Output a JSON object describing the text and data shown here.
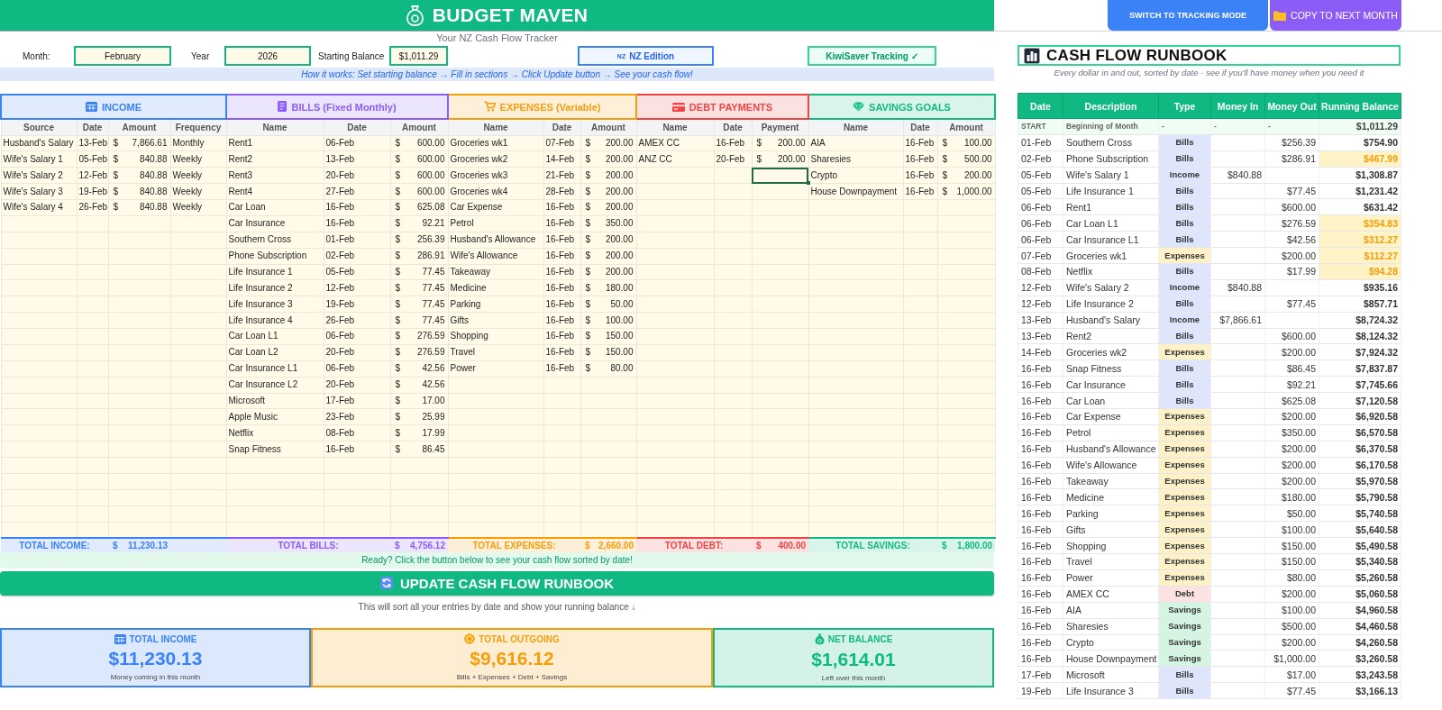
{
  "header": {
    "title": "BUDGET MAVEN",
    "subtitle": "Your NZ Cash Flow Tracker"
  },
  "controls": {
    "month_label": "Month:",
    "month": "February",
    "year_label": "Year",
    "year": "2026",
    "balance_label": "Starting Balance",
    "balance": "$1,011.29",
    "edition": {
      "badge": "NZ",
      "label": "NZ Edition"
    },
    "kiwisaver": "KiwiSaver Tracking ✓"
  },
  "how_it_works": "How it works: Set starting balance → Fill in sections → Click Update button → See your cash flow!",
  "sections": [
    {
      "kind": "income",
      "title": "INCOME",
      "color": "#3b82f6",
      "columns": [
        {
          "label": "Source",
          "kind": "text"
        },
        {
          "label": "Date",
          "kind": "text"
        },
        {
          "label": "Amount",
          "kind": "money"
        },
        {
          "label": "Frequency",
          "kind": "text"
        }
      ],
      "rows": [
        [
          "Husband's Salary",
          "13-Feb",
          [
            "$",
            "7,866.61"
          ],
          "Monthly"
        ],
        [
          "Wife's Salary 1",
          "05-Feb",
          [
            "$",
            "840.88"
          ],
          "Weekly"
        ],
        [
          "Wife's Salary 2",
          "12-Feb",
          [
            "$",
            "840.88"
          ],
          "Weekly"
        ],
        [
          "Wife's Salary 3",
          "19-Feb",
          [
            "$",
            "840.88"
          ],
          "Weekly"
        ],
        [
          "Wife's Salary 4",
          "26-Feb",
          [
            "$",
            "840.88"
          ],
          "Weekly"
        ]
      ],
      "total": {
        "label": "TOTAL INCOME:",
        "symbol": "$",
        "value": "11,230.13"
      }
    },
    {
      "kind": "bills",
      "title": "BILLS (Fixed Monthly)",
      "color": "#8b5cf6",
      "columns": [
        {
          "label": "Name",
          "kind": "text"
        },
        {
          "label": "Date",
          "kind": "text"
        },
        {
          "label": "Amount",
          "kind": "money"
        }
      ],
      "rows": [
        [
          "Rent1",
          "06-Feb",
          [
            "$",
            "600.00"
          ]
        ],
        [
          "Rent2",
          "13-Feb",
          [
            "$",
            "600.00"
          ]
        ],
        [
          "Rent3",
          "20-Feb",
          [
            "$",
            "600.00"
          ]
        ],
        [
          "Rent4",
          "27-Feb",
          [
            "$",
            "600.00"
          ]
        ],
        [
          "Car Loan",
          "16-Feb",
          [
            "$",
            "625.08"
          ]
        ],
        [
          "Car Insurance",
          "16-Feb",
          [
            "$",
            "92.21"
          ]
        ],
        [
          "Southern Cross",
          "01-Feb",
          [
            "$",
            "256.39"
          ]
        ],
        [
          "Phone Subscription",
          "02-Feb",
          [
            "$",
            "286.91"
          ]
        ],
        [
          "Life Insurance 1",
          "05-Feb",
          [
            "$",
            "77.45"
          ]
        ],
        [
          "Life Insurance 2",
          "12-Feb",
          [
            "$",
            "77.45"
          ]
        ],
        [
          "Life Insurance 3",
          "19-Feb",
          [
            "$",
            "77.45"
          ]
        ],
        [
          "Life Insurance 4",
          "26-Feb",
          [
            "$",
            "77.45"
          ]
        ],
        [
          "Car Loan L1",
          "06-Feb",
          [
            "$",
            "276.59"
          ]
        ],
        [
          "Car Loan L2",
          "20-Feb",
          [
            "$",
            "276.59"
          ]
        ],
        [
          "Car Insurance L1",
          "06-Feb",
          [
            "$",
            "42.56"
          ]
        ],
        [
          "Car Insurance L2",
          "20-Feb",
          [
            "$",
            "42.56"
          ]
        ],
        [
          "Microsoft",
          "17-Feb",
          [
            "$",
            "17.00"
          ]
        ],
        [
          "Apple Music",
          "23-Feb",
          [
            "$",
            "25.99"
          ]
        ],
        [
          "Netflix",
          "08-Feb",
          [
            "$",
            "17.99"
          ]
        ],
        [
          "Snap Fitness",
          "16-Feb",
          [
            "$",
            "86.45"
          ]
        ]
      ],
      "total": {
        "label": "TOTAL BILLS:",
        "symbol": "$",
        "value": "4,756.12"
      }
    },
    {
      "kind": "expenses",
      "title": "EXPENSES (Variable)",
      "color": "#f59e0b",
      "columns": [
        {
          "label": "Name",
          "kind": "text"
        },
        {
          "label": "Date",
          "kind": "text"
        },
        {
          "label": "Amount",
          "kind": "money"
        }
      ],
      "rows": [
        [
          "Groceries wk1",
          "07-Feb",
          [
            "$",
            "200.00"
          ]
        ],
        [
          "Groceries wk2",
          "14-Feb",
          [
            "$",
            "200.00"
          ]
        ],
        [
          "Groceries wk3",
          "21-Feb",
          [
            "$",
            "200.00"
          ]
        ],
        [
          "Groceries wk4",
          "28-Feb",
          [
            "$",
            "200.00"
          ]
        ],
        [
          "Car Expense",
          "16-Feb",
          [
            "$",
            "200.00"
          ]
        ],
        [
          "Petrol",
          "16-Feb",
          [
            "$",
            "350.00"
          ]
        ],
        [
          "Husband's Allowance",
          "16-Feb",
          [
            "$",
            "200.00"
          ]
        ],
        [
          "Wife's Allowance",
          "16-Feb",
          [
            "$",
            "200.00"
          ]
        ],
        [
          "Takeaway",
          "16-Feb",
          [
            "$",
            "200.00"
          ]
        ],
        [
          "Medicine",
          "16-Feb",
          [
            "$",
            "180.00"
          ]
        ],
        [
          "Parking",
          "16-Feb",
          [
            "$",
            "50.00"
          ]
        ],
        [
          "Gifts",
          "16-Feb",
          [
            "$",
            "100.00"
          ]
        ],
        [
          "Shopping",
          "16-Feb",
          [
            "$",
            "150.00"
          ]
        ],
        [
          "Travel",
          "16-Feb",
          [
            "$",
            "150.00"
          ]
        ],
        [
          "Power",
          "16-Feb",
          [
            "$",
            "80.00"
          ]
        ]
      ],
      "total": {
        "label": "TOTAL EXPENSES:",
        "symbol": "$",
        "value": "2,660.00"
      }
    },
    {
      "kind": "debt",
      "title": "DEBT PAYMENTS",
      "color": "#ef4444",
      "active_cell": true,
      "columns": [
        {
          "label": "Name",
          "kind": "text"
        },
        {
          "label": "Date",
          "kind": "text"
        },
        {
          "label": "Payment",
          "kind": "money"
        }
      ],
      "rows": [
        [
          "AMEX CC",
          "16-Feb",
          [
            "$",
            "200.00"
          ]
        ],
        [
          "ANZ CC",
          "20-Feb",
          [
            "$",
            "200.00"
          ]
        ]
      ],
      "total": {
        "label": "TOTAL DEBT:",
        "symbol": "$",
        "value": "400.00"
      }
    },
    {
      "kind": "savings",
      "title": "SAVINGS GOALS",
      "color": "#10b981",
      "columns": [
        {
          "label": "Name",
          "kind": "text"
        },
        {
          "label": "Date",
          "kind": "text"
        },
        {
          "label": "Amount",
          "kind": "money"
        }
      ],
      "rows": [
        [
          "AIA",
          "16-Feb",
          [
            "$",
            "100.00"
          ]
        ],
        [
          "Sharesies",
          "16-Feb",
          [
            "$",
            "500.00"
          ]
        ],
        [
          "Crypto",
          "16-Feb",
          [
            "$",
            "200.00"
          ]
        ],
        [
          "House Downpayment",
          "16-Feb",
          [
            "$",
            "1,000.00"
          ]
        ]
      ],
      "total": {
        "label": "TOTAL SAVINGS:",
        "symbol": "$",
        "value": "1,800.00"
      }
    }
  ],
  "ready_note": "Ready? Click the button below to see your cash flow sorted by date!",
  "update_button": "UPDATE CASH FLOW RUNBOOK",
  "update_caption": "This will sort all your entries by date and show your running balance ↓",
  "summary_cards": [
    {
      "kind": "income",
      "title": "TOTAL INCOME",
      "value": "$11,230.13",
      "caption": "Money coming in this month",
      "color": "#3b82f6"
    },
    {
      "kind": "outgoing",
      "title": "TOTAL OUTGOING",
      "value": "$9,616.12",
      "caption": "Bills + Expenses + Debt + Savings",
      "color": "#f59e0b"
    },
    {
      "kind": "net",
      "title": "NET BALANCE",
      "value": "$1,614.01",
      "caption": "Left over this month",
      "color": "#10b981"
    }
  ],
  "top_buttons": [
    {
      "kind": "switch",
      "label": "SWITCH TO TRACKING MODE"
    },
    {
      "kind": "copy",
      "label": "COPY TO NEXT MONTH"
    }
  ],
  "runbook": {
    "title": "CASH FLOW RUNBOOK",
    "subtitle": "Every dollar in and out, sorted by date - see if you'll have money when you need it",
    "columns": [
      "Date",
      "Description",
      "Type",
      "Money In",
      "Money Out",
      "Running Balance"
    ],
    "start": {
      "date": "START",
      "description": "Beginning of Month",
      "type": "-",
      "money_in": "-",
      "money_out": "-",
      "balance": "$1,011.29"
    },
    "rows": [
      {
        "date": "01-Feb",
        "description": "Southern Cross",
        "type": "Bills",
        "kind": "bills",
        "money_out": "$256.39",
        "balance": "$754.90",
        "warning": false
      },
      {
        "date": "02-Feb",
        "description": "Phone Subscription",
        "type": "Bills",
        "kind": "bills",
        "money_out": "$286.91",
        "balance": "$467.99",
        "warning": true
      },
      {
        "date": "05-Feb",
        "description": "Wife's Salary 1",
        "type": "Income",
        "kind": "income",
        "money_in": "$840.88",
        "balance": "$1,308.87",
        "warning": false
      },
      {
        "date": "05-Feb",
        "description": "Life Insurance 1",
        "type": "Bills",
        "kind": "bills",
        "money_out": "$77.45",
        "balance": "$1,231.42",
        "warning": false
      },
      {
        "date": "06-Feb",
        "description": "Rent1",
        "type": "Bills",
        "kind": "bills",
        "money_out": "$600.00",
        "balance": "$631.42",
        "warning": false
      },
      {
        "date": "06-Feb",
        "description": "Car Loan L1",
        "type": "Bills",
        "kind": "bills",
        "money_out": "$276.59",
        "balance": "$354.83",
        "warning": true
      },
      {
        "date": "06-Feb",
        "description": "Car Insurance L1",
        "type": "Bills",
        "kind": "bills",
        "money_out": "$42.56",
        "balance": "$312.27",
        "warning": true
      },
      {
        "date": "07-Feb",
        "description": "Groceries wk1",
        "type": "Expenses",
        "kind": "expenses",
        "money_out": "$200.00",
        "balance": "$112.27",
        "warning": true
      },
      {
        "date": "08-Feb",
        "description": "Netflix",
        "type": "Bills",
        "kind": "bills",
        "money_out": "$17.99",
        "balance": "$94.28",
        "warning": true
      },
      {
        "date": "12-Feb",
        "description": "Wife's Salary 2",
        "type": "Income",
        "kind": "income",
        "money_in": "$840.88",
        "balance": "$935.16",
        "warning": false
      },
      {
        "date": "12-Feb",
        "description": "Life Insurance 2",
        "type": "Bills",
        "kind": "bills",
        "money_out": "$77.45",
        "balance": "$857.71",
        "warning": false
      },
      {
        "date": "13-Feb",
        "description": "Husband's Salary",
        "type": "Income",
        "kind": "income",
        "money_in": "$7,866.61",
        "balance": "$8,724.32",
        "warning": false
      },
      {
        "date": "13-Feb",
        "description": "Rent2",
        "type": "Bills",
        "kind": "bills",
        "money_out": "$600.00",
        "balance": "$8,124.32",
        "warning": false
      },
      {
        "date": "14-Feb",
        "description": "Groceries wk2",
        "type": "Expenses",
        "kind": "expenses",
        "money_out": "$200.00",
        "balance": "$7,924.32",
        "warning": false
      },
      {
        "date": "16-Feb",
        "description": "Snap Fitness",
        "type": "Bills",
        "kind": "bills",
        "money_out": "$86.45",
        "balance": "$7,837.87",
        "warning": false
      },
      {
        "date": "16-Feb",
        "description": "Car Insurance",
        "type": "Bills",
        "kind": "bills",
        "money_out": "$92.21",
        "balance": "$7,745.66",
        "warning": false
      },
      {
        "date": "16-Feb",
        "description": "Car Loan",
        "type": "Bills",
        "kind": "bills",
        "money_out": "$625.08",
        "balance": "$7,120.58",
        "warning": false
      },
      {
        "date": "16-Feb",
        "description": "Car Expense",
        "type": "Expenses",
        "kind": "expenses",
        "money_out": "$200.00",
        "balance": "$6,920.58",
        "warning": false
      },
      {
        "date": "16-Feb",
        "description": "Petrol",
        "type": "Expenses",
        "kind": "expenses",
        "money_out": "$350.00",
        "balance": "$6,570.58",
        "warning": false
      },
      {
        "date": "16-Feb",
        "description": "Husband's Allowance",
        "type": "Expenses",
        "kind": "expenses",
        "money_out": "$200.00",
        "balance": "$6,370.58",
        "warning": false
      },
      {
        "date": "16-Feb",
        "description": "Wife's Allowance",
        "type": "Expenses",
        "kind": "expenses",
        "money_out": "$200.00",
        "balance": "$6,170.58",
        "warning": false
      },
      {
        "date": "16-Feb",
        "description": "Takeaway",
        "type": "Expenses",
        "kind": "expenses",
        "money_out": "$200.00",
        "balance": "$5,970.58",
        "warning": false
      },
      {
        "date": "16-Feb",
        "description": "Medicine",
        "type": "Expenses",
        "kind": "expenses",
        "money_out": "$180.00",
        "balance": "$5,790.58",
        "warning": false
      },
      {
        "date": "16-Feb",
        "description": "Parking",
        "type": "Expenses",
        "kind": "expenses",
        "money_out": "$50.00",
        "balance": "$5,740.58",
        "warning": false
      },
      {
        "date": "16-Feb",
        "description": "Gifts",
        "type": "Expenses",
        "kind": "expenses",
        "money_out": "$100.00",
        "balance": "$5,640.58",
        "warning": false
      },
      {
        "date": "16-Feb",
        "description": "Shopping",
        "type": "Expenses",
        "kind": "expenses",
        "money_out": "$150.00",
        "balance": "$5,490.58",
        "warning": false
      },
      {
        "date": "16-Feb",
        "description": "Travel",
        "type": "Expenses",
        "kind": "expenses",
        "money_out": "$150.00",
        "balance": "$5,340.58",
        "warning": false
      },
      {
        "date": "16-Feb",
        "description": "Power",
        "type": "Expenses",
        "kind": "expenses",
        "money_out": "$80.00",
        "balance": "$5,260.58",
        "warning": false
      },
      {
        "date": "16-Feb",
        "description": "AMEX CC",
        "type": "Debt",
        "kind": "debt",
        "money_out": "$200.00",
        "balance": "$5,060.58",
        "warning": false
      },
      {
        "date": "16-Feb",
        "description": "AIA",
        "type": "Savings",
        "kind": "savings",
        "money_out": "$100.00",
        "balance": "$4,960.58",
        "warning": false
      },
      {
        "date": "16-Feb",
        "description": "Sharesies",
        "type": "Savings",
        "kind": "savings",
        "money_out": "$500.00",
        "balance": "$4,460.58",
        "warning": false
      },
      {
        "date": "16-Feb",
        "description": "Crypto",
        "type": "Savings",
        "kind": "savings",
        "money_out": "$200.00",
        "balance": "$4,260.58",
        "warning": false
      },
      {
        "date": "16-Feb",
        "description": "House Downpayment",
        "type": "Savings",
        "kind": "savings",
        "money_out": "$1,000.00",
        "balance": "$3,260.58",
        "warning": false
      },
      {
        "date": "17-Feb",
        "description": "Microsoft",
        "type": "Bills",
        "kind": "bills",
        "money_out": "$17.00",
        "balance": "$3,243.58",
        "warning": false
      },
      {
        "date": "19-Feb",
        "description": "Life Insurance 3",
        "type": "Bills",
        "kind": "bills",
        "money_out": "$77.45",
        "balance": "$3,166.13",
        "warning": false
      }
    ]
  }
}
